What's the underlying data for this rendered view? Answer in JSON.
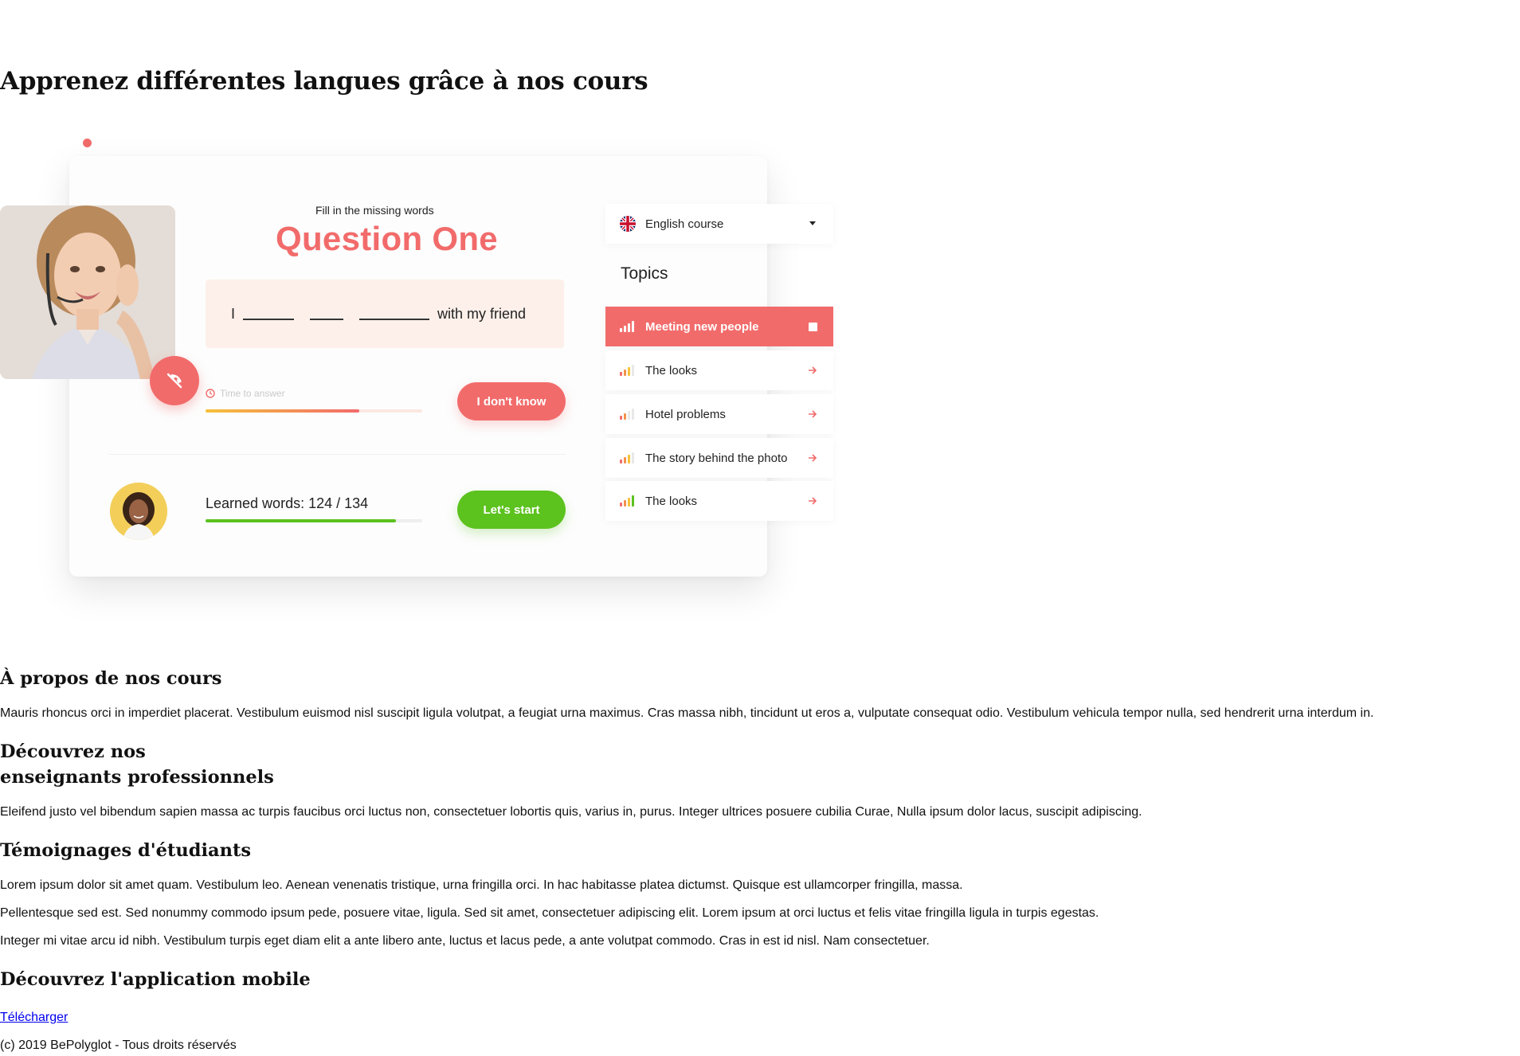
{
  "hero": {
    "title": "Apprenez différentes langues grâce à nos cours"
  },
  "mockup": {
    "question": {
      "subtitle": "Fill in the missing words",
      "title": "Question One",
      "sentence_start": "I",
      "sentence_end": "with my friend"
    },
    "timer": {
      "label": "Time to answer",
      "progress": 0.71
    },
    "dont_know_button": "I don't know",
    "learned": {
      "label": "Learned words: 124 / 134",
      "progress": 0.88
    },
    "start_button": "Let's start",
    "course_select": {
      "value": "English course"
    },
    "topics_label": "Topics",
    "topics": [
      {
        "label": "Meeting new people",
        "active": true,
        "level": 4
      },
      {
        "label": "The looks",
        "active": false,
        "level": 3
      },
      {
        "label": "Hotel problems",
        "active": false,
        "level": 2
      },
      {
        "label": "The story behind the photo",
        "active": false,
        "level": 3
      },
      {
        "label": "The looks",
        "active": false,
        "level": 4
      }
    ],
    "colors": {
      "accent": "#f26b6b",
      "success": "#5cc21e",
      "question_bg": "#fdf0ea"
    }
  },
  "sections": {
    "about": {
      "heading": "À propos de nos cours",
      "text": "Mauris rhoncus orci in imperdiet placerat. Vestibulum euismod nisl suscipit ligula volutpat, a feugiat urna maximus. Cras massa nibh, tincidunt ut eros a, vulputate consequat odio. Vestibulum vehicula tempor nulla, sed hendrerit urna interdum in."
    },
    "teachers": {
      "heading_line1": "Découvrez nos",
      "heading_line2": "enseignants professionnels",
      "text": "Eleifend justo vel bibendum sapien massa ac turpis faucibus orci luctus non, consectetuer lobortis quis, varius in, purus. Integer ultrices posuere cubilia Curae, Nulla ipsum dolor lacus, suscipit adipiscing."
    },
    "testimonials": {
      "heading": "Témoignages d'étudiants",
      "items": [
        "Lorem ipsum dolor sit amet quam. Vestibulum leo. Aenean venenatis tristique, urna fringilla orci. In hac habitasse platea dictumst. Quisque est ullamcorper fringilla, massa.",
        "Pellentesque sed est. Sed nonummy commodo ipsum pede, posuere vitae, ligula. Sed sit amet, consectetuer adipiscing elit. Lorem ipsum at orci luctus et felis vitae fringilla ligula in turpis egestas.",
        "Integer mi vitae arcu id nibh. Vestibulum turpis eget diam elit a ante libero ante, luctus et lacus pede, a ante volutpat commodo. Cras in est id nisl. Nam consectetuer."
      ]
    },
    "mobile": {
      "heading": "Découvrez l'application mobile",
      "link": "Télécharger"
    }
  },
  "footer": {
    "text": "(c) 2019 BePolyglot - Tous droits réservés"
  }
}
